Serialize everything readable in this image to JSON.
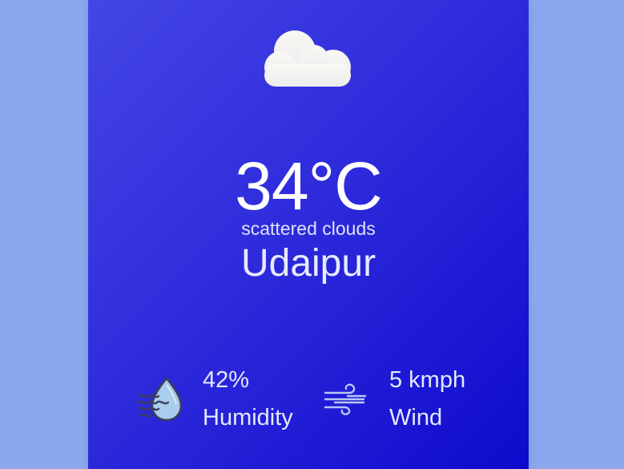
{
  "weather": {
    "icon": "cloud-icon",
    "temperature": "34°C",
    "description": "scattered clouds",
    "city": "Udaipur"
  },
  "humidity": {
    "icon": "humidity-drop-icon",
    "value": "42%",
    "label": "Humidity"
  },
  "wind": {
    "icon": "wind-icon",
    "value": "5 kmph",
    "label": "Wind"
  },
  "colors": {
    "page_background": "#8ba8ee",
    "card_gradient_start": "#4446e4",
    "card_gradient_end": "#0e0acd",
    "text_primary": "#ffffff"
  }
}
